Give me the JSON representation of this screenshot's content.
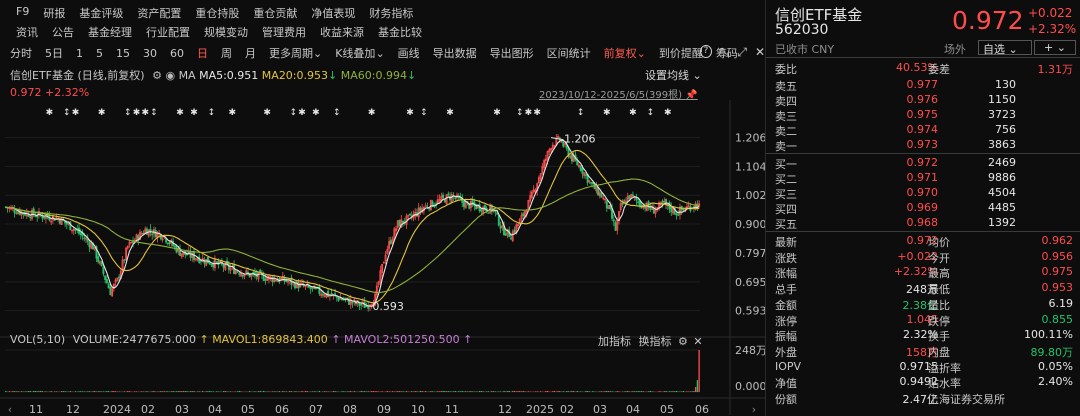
{
  "menu": {
    "row1": [
      "F9",
      "研报",
      "基金评级",
      "资产配置",
      "重仓持股",
      "重仓贡献",
      "净值表现",
      "财务指标"
    ],
    "row2": [
      "资讯",
      "公告",
      "基金经理",
      "行业配置",
      "规模变动",
      "管理费用",
      "收益来源",
      "基金比较"
    ]
  },
  "toolbar": {
    "items": [
      "分时",
      "5日",
      "1",
      "5",
      "15",
      "30",
      "60",
      "日",
      "周",
      "月",
      "更多周期",
      "K线叠加",
      "画线",
      "导出数据",
      "导出图形",
      "区间统计",
      "前复权",
      "到价提醒",
      "筹码"
    ],
    "active": [
      "日",
      "前复权"
    ],
    "icons": [
      "help-icon",
      "collapse-icon",
      "expand-icon",
      "close-icon"
    ]
  },
  "info": {
    "name_period": "信创ETF基金 (日线,前复权)",
    "ma_label": "MA",
    "ma5": "MA5:0.951",
    "ma20": "MA20:0.953",
    "ma60": "MA60:0.994",
    "price_line": "0.972 +2.32%",
    "settings": "设置均线",
    "range": "2023/10/12-2025/6/5(399根)"
  },
  "volume_info": {
    "vol": "VOL(5,10)",
    "volume": "VOLUME:2477675.000",
    "mavol1": "MAVOL1:869843.400",
    "mavol2": "MAVOL2:501250.500",
    "add": "加指标",
    "swap": "换指标"
  },
  "colors": {
    "up": "#ff4d4d",
    "down": "#26c26a",
    "ma5": "#e6e6e6",
    "ma20": "#e3c43a",
    "ma60": "#8fb13a",
    "vol": "#c77dd6",
    "bg": "#0d0d0d"
  },
  "chart_data": {
    "type": "candlestick",
    "title": "信创ETF基金 (日线,前复权)",
    "range": "2023/10/12-2025/6/5",
    "bars": 399,
    "ylim": [
      0.56,
      1.24
    ],
    "y_ticks": [
      "1.206",
      "1.104",
      "1.002",
      "0.900",
      "0.797",
      "0.695",
      "0.593"
    ],
    "x_ticks": [
      "11",
      "12",
      "2024",
      "02",
      "03",
      "04",
      "05",
      "06",
      "07",
      "08",
      "09",
      "10",
      "11",
      "12",
      "2025",
      "02",
      "03",
      "04",
      "05",
      "06"
    ],
    "annotations": {
      "high": "1.206",
      "low": "0.593"
    },
    "close_anchors": [
      [
        0,
        0.96
      ],
      [
        10,
        0.94
      ],
      [
        20,
        0.93
      ],
      [
        30,
        0.92
      ],
      [
        40,
        0.88
      ],
      [
        50,
        0.82
      ],
      [
        55,
        0.74
      ],
      [
        60,
        0.66
      ],
      [
        64,
        0.7
      ],
      [
        70,
        0.82
      ],
      [
        80,
        0.88
      ],
      [
        90,
        0.86
      ],
      [
        100,
        0.8
      ],
      [
        110,
        0.78
      ],
      [
        120,
        0.76
      ],
      [
        130,
        0.74
      ],
      [
        140,
        0.72
      ],
      [
        150,
        0.71
      ],
      [
        160,
        0.7
      ],
      [
        170,
        0.68
      ],
      [
        180,
        0.66
      ],
      [
        190,
        0.64
      ],
      [
        200,
        0.62
      ],
      [
        207,
        0.61
      ],
      [
        212,
        0.64
      ],
      [
        218,
        0.8
      ],
      [
        225,
        0.9
      ],
      [
        232,
        0.92
      ],
      [
        240,
        0.96
      ],
      [
        248,
        0.98
      ],
      [
        256,
        1.0
      ],
      [
        264,
        0.97
      ],
      [
        272,
        0.96
      ],
      [
        280,
        0.95
      ],
      [
        285,
        0.88
      ],
      [
        290,
        0.86
      ],
      [
        296,
        0.92
      ],
      [
        302,
        1.0
      ],
      [
        308,
        1.1
      ],
      [
        313,
        1.18
      ],
      [
        318,
        1.2
      ],
      [
        324,
        1.14
      ],
      [
        330,
        1.1
      ],
      [
        336,
        1.04
      ],
      [
        342,
        1.0
      ],
      [
        347,
        0.94
      ],
      [
        350,
        0.88
      ],
      [
        353,
        0.96
      ],
      [
        358,
        1.0
      ],
      [
        365,
        0.97
      ],
      [
        372,
        0.95
      ],
      [
        378,
        0.97
      ],
      [
        385,
        0.94
      ],
      [
        392,
        0.96
      ],
      [
        398,
        0.972
      ]
    ],
    "volume": {
      "ylim": [
        0,
        248
      ],
      "y_ticks": [
        "248万",
        "0.000"
      ],
      "last": 247.7,
      "unit": "万"
    }
  },
  "quote": {
    "name": "信创ETF基金",
    "code": "562030",
    "status": "已收市 CNY",
    "price": "0.972",
    "change": "+0.022",
    "pct": "+2.32%",
    "market": "场外",
    "watch": "自选",
    "plus": "+",
    "webi_label": "委比",
    "webi": "40.53%",
    "wecha_label": "委差",
    "wecha": "1.31万",
    "asks": [
      {
        "label": "卖五",
        "price": "0.977",
        "vol": "130"
      },
      {
        "label": "卖四",
        "price": "0.976",
        "vol": "1150"
      },
      {
        "label": "卖三",
        "price": "0.975",
        "vol": "3723"
      },
      {
        "label": "卖二",
        "price": "0.974",
        "vol": "756"
      },
      {
        "label": "卖一",
        "price": "0.973",
        "vol": "3863"
      }
    ],
    "bids": [
      {
        "label": "买一",
        "price": "0.972",
        "vol": "2469"
      },
      {
        "label": "买二",
        "price": "0.971",
        "vol": "9886"
      },
      {
        "label": "买三",
        "price": "0.970",
        "vol": "4504"
      },
      {
        "label": "买四",
        "price": "0.969",
        "vol": "4485"
      },
      {
        "label": "买五",
        "price": "0.968",
        "vol": "1392"
      }
    ],
    "stats": [
      {
        "l1": "最新",
        "v1": "0.972",
        "c1": "red",
        "l2": "均价",
        "v2": "0.962",
        "c2": "red"
      },
      {
        "l1": "涨跌",
        "v1": "+0.022",
        "c1": "red",
        "l2": "今开",
        "v2": "0.956",
        "c2": "red"
      },
      {
        "l1": "涨幅",
        "v1": "+2.32%",
        "c1": "red",
        "l2": "最高",
        "v2": "0.975",
        "c2": "red"
      },
      {
        "l1": "总手",
        "v1": "248万",
        "c1": "white",
        "l2": "最低",
        "v2": "0.953",
        "c2": "red"
      },
      {
        "l1": "金额",
        "v1": "2.38亿",
        "c1": "green",
        "l2": "量比",
        "v2": "6.19",
        "c2": "white"
      },
      {
        "l1": "涨停",
        "v1": "1.045",
        "c1": "red",
        "l2": "跌停",
        "v2": "0.855",
        "c2": "green"
      },
      {
        "l1": "振幅",
        "v1": "2.32%",
        "c1": "white",
        "l2": "换手",
        "v2": "100.11%",
        "c2": "white"
      },
      {
        "l1": "外盘",
        "v1": "158万",
        "c1": "red",
        "l2": "内盘",
        "v2": "89.80万",
        "c2": "green"
      },
      {
        "l1": "IOPV",
        "v1": "0.9715",
        "c1": "white",
        "l2": "溢折率",
        "v2": "0.05%",
        "c2": "white"
      },
      {
        "l1": "净值",
        "v1": "0.9492",
        "c1": "white",
        "l2": "贴水率",
        "v2": "2.40%",
        "c2": "white"
      },
      {
        "l1": "份额",
        "v1": "2.47亿",
        "c1": "white",
        "l2": "上海证券交易所",
        "v2": "",
        "c2": "white"
      }
    ]
  }
}
